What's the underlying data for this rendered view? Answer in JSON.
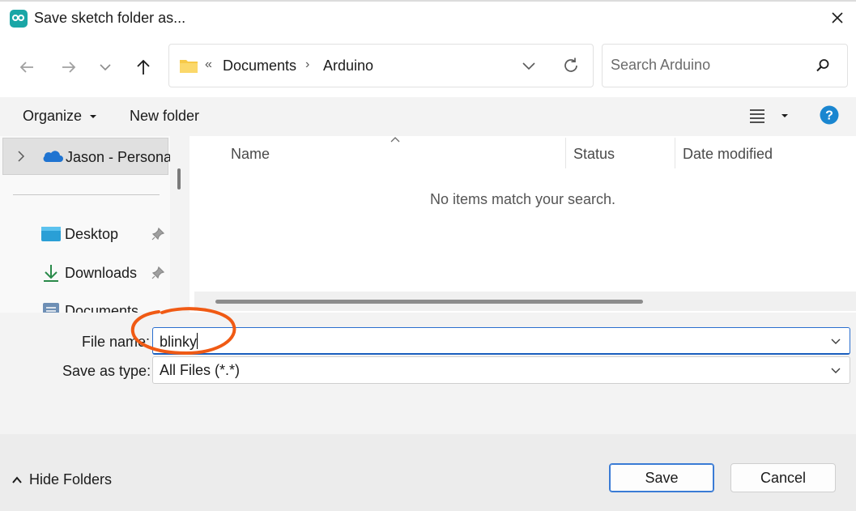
{
  "window": {
    "title": "Save sketch folder as...",
    "close_glyph": "✕"
  },
  "nav": {
    "breadcrumb": {
      "overflow": "«",
      "items": [
        "Documents",
        "Arduino"
      ],
      "separator": "›"
    },
    "search_placeholder": "Search Arduino"
  },
  "toolbar": {
    "organize": "Organize",
    "new_folder": "New folder"
  },
  "sidebar": {
    "selected": "Jason - Personal",
    "items": [
      {
        "label": "Desktop"
      },
      {
        "label": "Downloads"
      },
      {
        "label": "Documents"
      }
    ]
  },
  "file_list": {
    "columns": [
      "Name",
      "Status",
      "Date modified"
    ],
    "empty_message": "No items match your search."
  },
  "form": {
    "file_name_label": "File name:",
    "file_name_value": "blinky",
    "save_type_label": "Save as type:",
    "save_type_value": "All Files (*.*)"
  },
  "footer": {
    "hide_folders": "Hide Folders",
    "save": "Save",
    "cancel": "Cancel"
  },
  "colors": {
    "accent": "#1a5fbf",
    "annotation": "#f05a14",
    "help": "#1a86d0"
  }
}
